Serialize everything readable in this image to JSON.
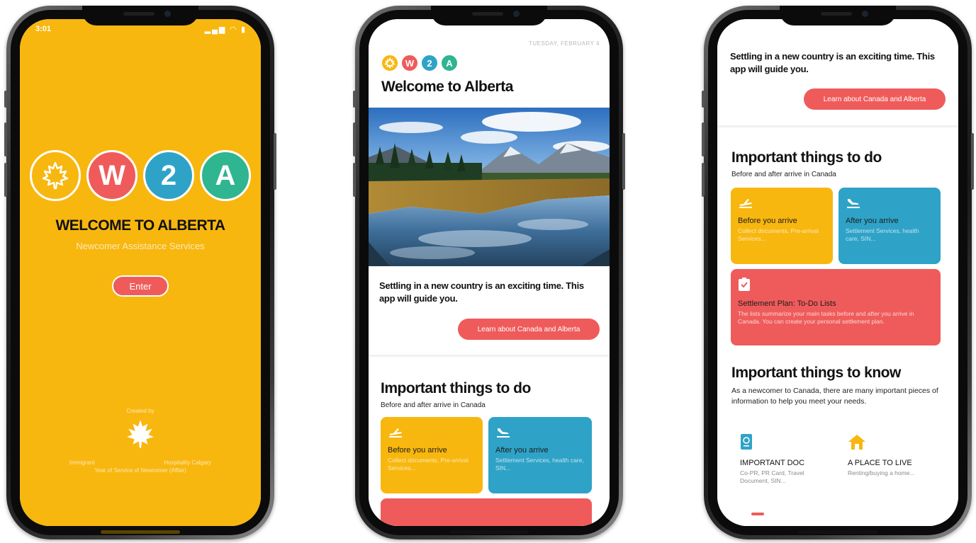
{
  "colors": {
    "yellow": "#f8b70f",
    "red": "#ef5b5b",
    "blue": "#2fa3c7",
    "green": "#2fb58f"
  },
  "logo": {
    "icons": [
      "maple-leaf-icon"
    ],
    "letters": [
      "W",
      "2",
      "A"
    ]
  },
  "splash": {
    "status_time": "3:01",
    "status_icons": [
      "signal-icon",
      "wifi-icon",
      "battery-icon"
    ],
    "title": "WELCOME TO ALBERTA",
    "subtitle": "Newcomer Assistance Services",
    "enter_label": "Enter",
    "created_by": "Created by",
    "credit_left": "Immigrant",
    "credit_right": "Hospitality Calgary",
    "credit_bottom": "Year of Service of Newcomer (Affair)"
  },
  "home": {
    "date": "TUESDAY, FEBRUARY 4",
    "title": "Welcome to Alberta",
    "hero_icon": "mountain-lake-photo",
    "intro": "Settling in a new country is an exciting time. This app will guide you.",
    "learn_label": "Learn about Canada and Alberta"
  },
  "todo": {
    "title": "Important things to do",
    "subtitle": "Before and after arrive in Canada",
    "tiles": [
      {
        "icon": "plane-takeoff-icon",
        "title": "Before you arrive",
        "desc": "Collect documents, Pre-arrival Services..."
      },
      {
        "icon": "plane-landing-icon",
        "title": "After you arrive",
        "desc": "Settlement Services, health care, SIN..."
      },
      {
        "icon": "checklist-icon",
        "title": "Settlement Plan: To-Do Lists",
        "desc": "The lists summarize your main tasks before and after you arrive in Canada. You can create your personal settlement plan."
      }
    ]
  },
  "know": {
    "title": "Important things to know",
    "intro": "As a newcomer to Canada, there are many important pieces of information to help you meet your needs.",
    "items": [
      {
        "icon": "passport-icon",
        "title": "IMPORTANT DOC",
        "desc": "Co-PR, PR Card, Travel Document, SIN..."
      },
      {
        "icon": "house-icon",
        "title": "A PLACE TO LIVE",
        "desc": "Renting/buying a home..."
      }
    ]
  }
}
